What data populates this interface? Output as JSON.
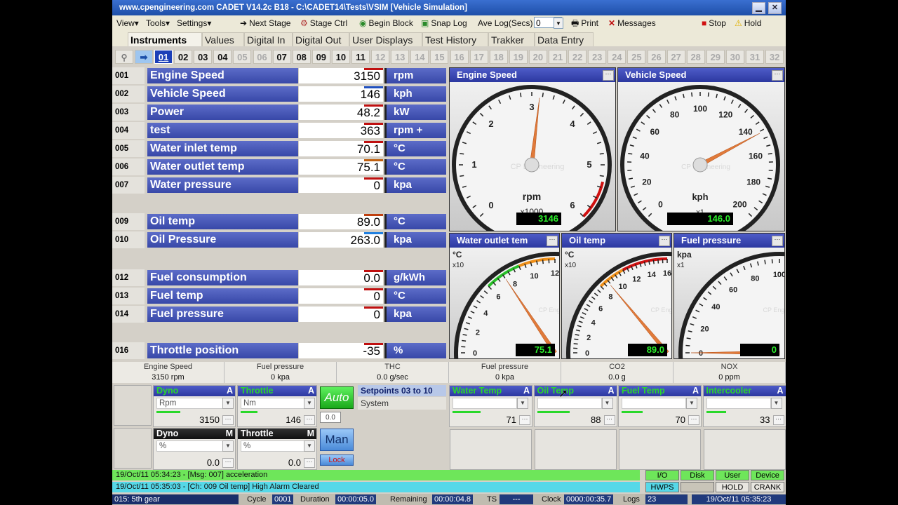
{
  "window": {
    "title": "www.cpengineering.com      CADET V14.2c  B18  -  C:\\CADET14\\Tests\\VSIM   [Vehicle Simulation]"
  },
  "toolbar": {
    "view": "View",
    "tools": "Tools",
    "settings": "Settings",
    "next_stage": "Next Stage",
    "stage_ctrl": "Stage Ctrl",
    "begin_block": "Begin Block",
    "snap_log": "Snap Log",
    "ave_log_label": "Ave Log(Secs)",
    "ave_log_value": "0",
    "print": "Print",
    "messages": "Messages",
    "stop": "Stop",
    "hold": "Hold"
  },
  "tabs": [
    "Instruments",
    "Values",
    "Digital In",
    "Digital Out",
    "User Displays",
    "Test History",
    "Trakker",
    "Data Entry"
  ],
  "channel_buttons": [
    "01",
    "02",
    "03",
    "04",
    "05",
    "06",
    "07",
    "08",
    "09",
    "10",
    "11",
    "12",
    "13",
    "14",
    "15",
    "16",
    "17",
    "18",
    "19",
    "20",
    "21",
    "22",
    "23",
    "24",
    "25",
    "26",
    "27",
    "28",
    "29",
    "30",
    "31",
    "32"
  ],
  "channels": [
    {
      "num": "001",
      "name": "Engine Speed",
      "value": "3150",
      "unit": "rpm"
    },
    {
      "num": "002",
      "name": "Vehicle Speed",
      "value": "146",
      "unit": "kph"
    },
    {
      "num": "003",
      "name": "Power",
      "value": "48.2",
      "unit": "kW"
    },
    {
      "num": "004",
      "name": "test",
      "value": "363",
      "unit": "rpm +"
    },
    {
      "num": "005",
      "name": "Water inlet temp",
      "value": "70.1",
      "unit": "°C"
    },
    {
      "num": "006",
      "name": "Water outlet temp",
      "value": "75.1",
      "unit": "°C"
    },
    {
      "num": "007",
      "name": "Water pressure",
      "value": "0",
      "unit": "kpa"
    },
    {
      "num": "009",
      "name": "Oil temp",
      "value": "89.0",
      "unit": "°C"
    },
    {
      "num": "010",
      "name": "Oil Pressure",
      "value": "263.0",
      "unit": "kpa"
    },
    {
      "num": "012",
      "name": "Fuel consumption",
      "value": "0.0",
      "unit": "g/kWh"
    },
    {
      "num": "013",
      "name": "Fuel temp",
      "value": "0",
      "unit": "°C"
    },
    {
      "num": "014",
      "name": "Fuel pressure",
      "value": "0",
      "unit": "kpa"
    },
    {
      "num": "016",
      "name": "Throttle position",
      "value": "-35",
      "unit": "%"
    }
  ],
  "gauges": {
    "engine_speed": {
      "title": "Engine Speed",
      "unit": "rpm",
      "scale": "x1000",
      "ticks": [
        "0",
        "1",
        "2",
        "3",
        "4",
        "5",
        "6"
      ],
      "min": 0,
      "max": 6,
      "value": 3.146,
      "readout": "3146",
      "watermark": "CP Engineering"
    },
    "vehicle_speed": {
      "title": "Vehicle Speed",
      "unit": "kph",
      "scale": "x1",
      "ticks": [
        "0",
        "20",
        "40",
        "60",
        "80",
        "100",
        "120",
        "140",
        "160",
        "180",
        "200"
      ],
      "min": 0,
      "max": 200,
      "value": 146,
      "readout": "146.0",
      "watermark": "CP Engineering"
    },
    "water_outlet": {
      "title": "Water outlet tem",
      "unit": "°C",
      "scale": "x10",
      "ticks": [
        "0",
        "2",
        "4",
        "6",
        "8",
        "10",
        "12"
      ],
      "min": 0,
      "max": 12,
      "value": 7.51,
      "readout": "75.1",
      "watermark": "CP Engineering"
    },
    "oil_temp": {
      "title": "Oil temp",
      "unit": "°C",
      "scale": "x10",
      "ticks": [
        "0",
        "2",
        "4",
        "6",
        "8",
        "10",
        "12",
        "14",
        "16"
      ],
      "min": 0,
      "max": 16,
      "value": 8.9,
      "readout": "89.0",
      "watermark": "CP Engineering"
    },
    "fuel_pressure": {
      "title": "Fuel pressure",
      "unit": "kpa",
      "scale": "x1",
      "ticks": [
        "0",
        "20",
        "40",
        "60",
        "80",
        "100"
      ],
      "min": 0,
      "max": 100,
      "value": 0,
      "readout": "0",
      "watermark": "CP Engineering"
    }
  },
  "summary": [
    {
      "label": "Engine Speed",
      "value": "3150 rpm"
    },
    {
      "label": "Fuel pressure",
      "value": "0 kpa"
    },
    {
      "label": "THC",
      "value": "0.0 g/sec"
    },
    {
      "label": "Fuel pressure",
      "value": "0 kpa"
    },
    {
      "label": "CO2",
      "value": "0.0 g"
    },
    {
      "label": "NOX",
      "value": "0 ppm"
    }
  ],
  "controls": {
    "dyno_a": {
      "title": "Dyno",
      "mode": "A",
      "unit": "Rpm",
      "value": "3150"
    },
    "throttle_a": {
      "title": "Throttle",
      "mode": "A",
      "unit": "Nm",
      "value": "146"
    },
    "dyno_m": {
      "title": "Dyno",
      "mode": "M",
      "unit": "%",
      "value": "0.0"
    },
    "throttle_m": {
      "title": "Throttle",
      "mode": "M",
      "unit": "%",
      "value": "0.0"
    },
    "auto_label": "Auto",
    "auto_value": "0.0",
    "man_label": "Man",
    "lock_label": "Lock",
    "setpoints_title": "Setpoints 03 to 10",
    "setpoints_item": "System",
    "water_temp": {
      "title": "Water Temp",
      "mode": "A",
      "value": "71"
    },
    "oil_temp": {
      "title": "Oil Temp",
      "mode": "A",
      "value": "88"
    },
    "fuel_temp": {
      "title": "Fuel Temp",
      "mode": "A",
      "value": "70"
    },
    "intercooler": {
      "title": "Intercooler",
      "mode": "A",
      "value": "33"
    }
  },
  "messages": [
    "19/Oct/11 05:34:23 - [Msg: 007] acceleration",
    "19/Oct/11 05:35:03 - [Ch: 009 Oil temp] High Alarm Cleared"
  ],
  "status_indicators": [
    "I/O",
    "Disk",
    "User",
    "Device",
    "HWPS",
    "",
    "HOLD",
    "CRANK"
  ],
  "statusbar": {
    "stage": "015: 5th gear",
    "cycle_label": "Cycle",
    "cycle": "0001",
    "duration_label": "Duration",
    "duration": "00:00:05.0",
    "remaining_label": "Remaining",
    "remaining": "00:00:04.8",
    "ts_label": "TS",
    "ts": "---",
    "clock_label": "Clock",
    "clock": "0000:00:35.7",
    "logs_label": "Logs",
    "logs": "23",
    "datetime": "19/Oct/11 05:35:23"
  },
  "colors": {
    "channel_bar": "#3848a8",
    "readout_green": "#2cf02c",
    "message_green": "#6ee65a",
    "message_cyan": "#56d8e8"
  }
}
